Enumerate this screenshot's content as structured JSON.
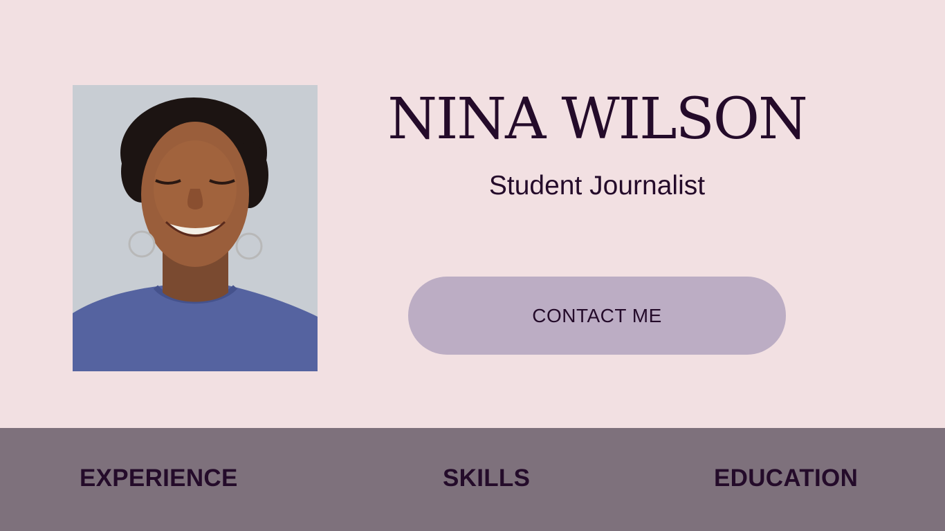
{
  "profile": {
    "name": "NINA WILSON",
    "role": "Student Journalist",
    "photo_alt": "portrait photo"
  },
  "contact_button": {
    "label": "CONTACT ME"
  },
  "nav": {
    "items": [
      {
        "label": "EXPERIENCE"
      },
      {
        "label": "SKILLS"
      },
      {
        "label": "EDUCATION"
      }
    ]
  },
  "colors": {
    "background": "#f2e0e2",
    "navbar": "#7e717c",
    "button": "#bcadc4",
    "text": "#240b2a"
  }
}
